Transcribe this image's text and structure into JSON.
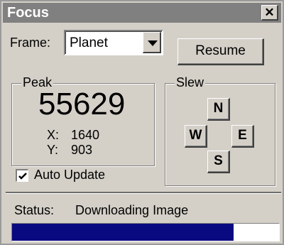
{
  "window": {
    "title": "Focus",
    "close_symbol": "✕"
  },
  "frame": {
    "label": "Frame:",
    "selected": "Planet"
  },
  "resume_button": {
    "label": "Resume"
  },
  "peak": {
    "legend": "Peak",
    "value": "55629",
    "x_label": "X:",
    "x_value": "1640",
    "y_label": "Y:",
    "y_value": "903"
  },
  "auto_update": {
    "label": "Auto Update",
    "checked": true
  },
  "slew": {
    "legend": "Slew",
    "north": "N",
    "south": "S",
    "east": "E",
    "west": "W"
  },
  "status": {
    "label": "Status:",
    "text": "Downloading Image"
  },
  "progress": {
    "fraction": 0.83
  },
  "colors": {
    "titlebar": "#808080",
    "face": "#d4d0c8",
    "progress_fill": "#0a0a80"
  }
}
